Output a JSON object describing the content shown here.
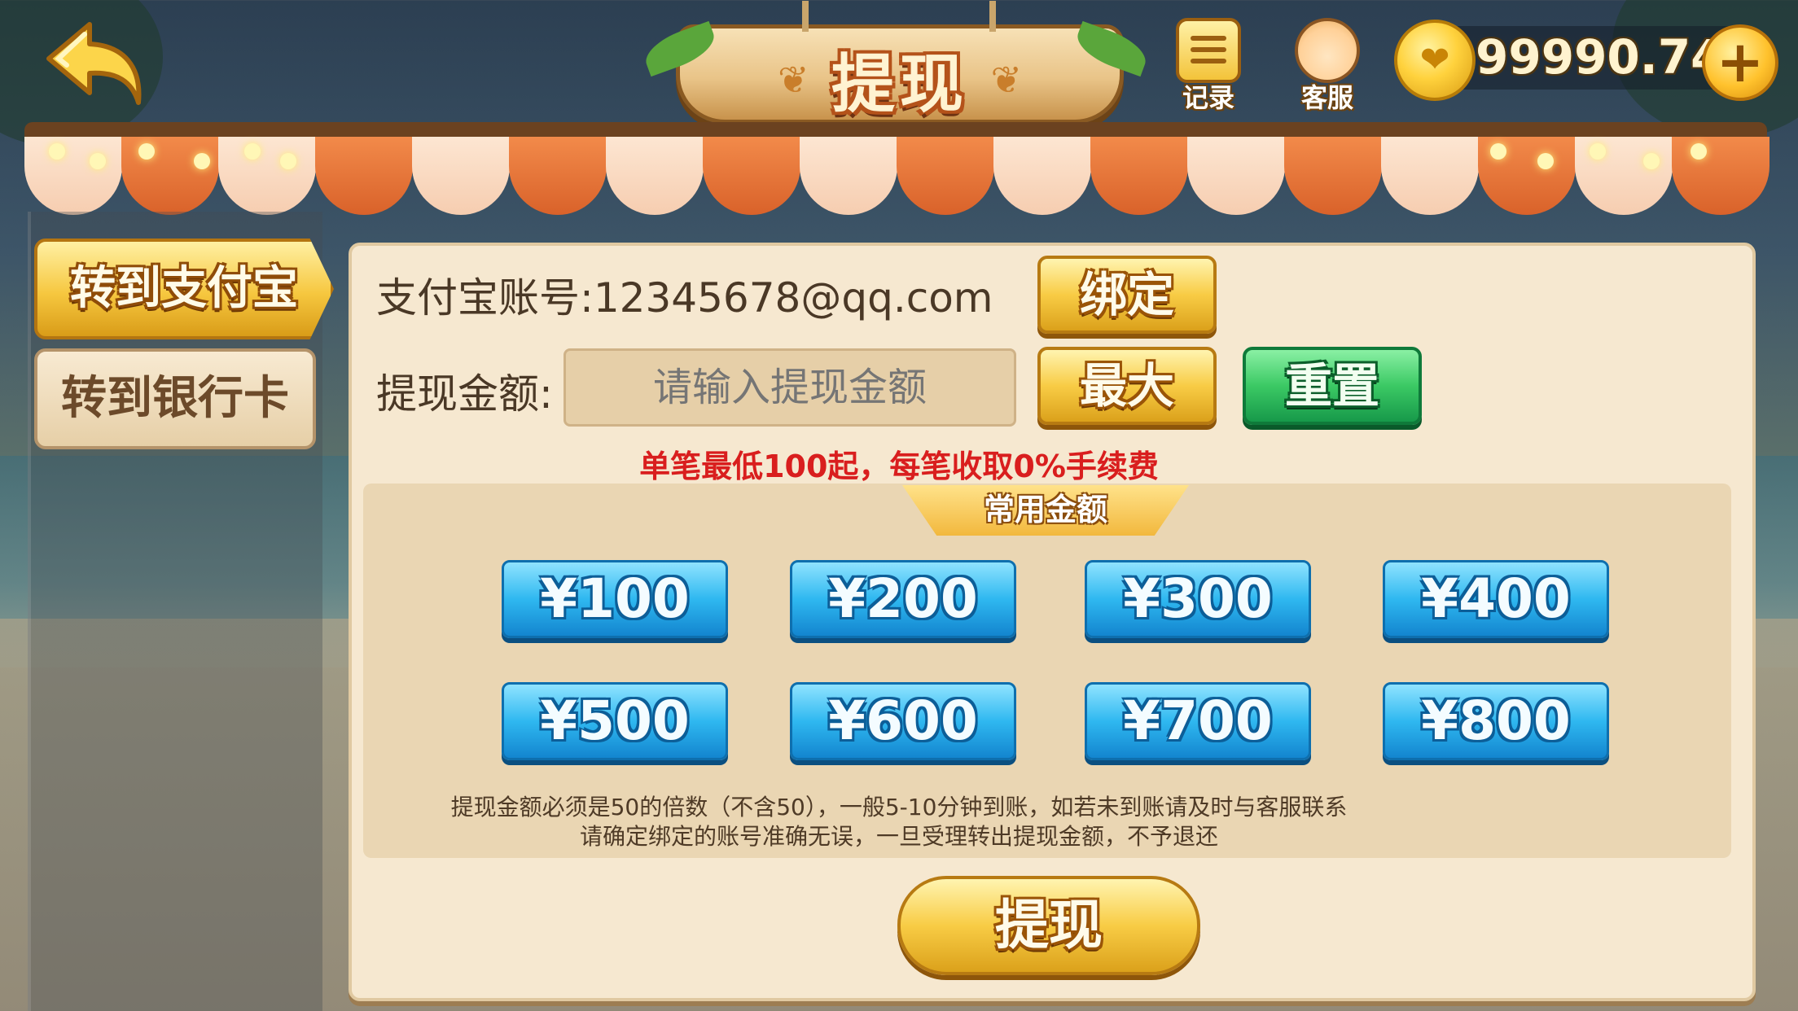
{
  "header": {
    "title": "提现",
    "records_label": "记录",
    "service_label": "客服",
    "balance": "99990.74"
  },
  "tabs": [
    {
      "label": "转到支付宝",
      "active": true
    },
    {
      "label": "转到银行卡",
      "active": false
    }
  ],
  "form": {
    "account_label": "支付宝账号:12345678@qq.com",
    "bind_label": "绑定",
    "amount_label": "提现金额:",
    "amount_placeholder": "请输入提现金额",
    "max_label": "最大",
    "reset_label": "重置",
    "fee_note": "单笔最低100起，每笔收取0%手续费"
  },
  "presets": {
    "title": "常用金额",
    "amounts": [
      "¥100",
      "¥200",
      "¥300",
      "¥400",
      "¥500",
      "¥600",
      "¥700",
      "¥800"
    ]
  },
  "rules": [
    "提现金额必须是50的倍数（不含50），一般5-10分钟到账，如若未到账请及时与客服联系",
    "请确定绑定的账号准确无误，一旦受理转出提现金额，不予退还"
  ],
  "submit_label": "提现",
  "colors": {
    "accent_gold": "#f8cc45",
    "accent_blue": "#2fb8f0",
    "accent_green": "#3bc964",
    "warning_red": "#d91e1e"
  }
}
